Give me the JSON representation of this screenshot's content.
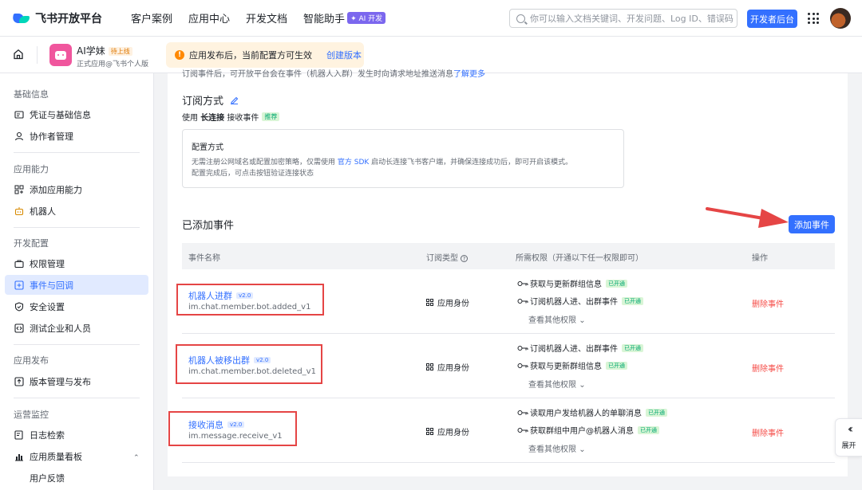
{
  "topnav": {
    "brand": "飞书开放平台",
    "links": [
      "客户案例",
      "应用中心",
      "开发文档",
      "智能助手"
    ],
    "ai_badge": "AI 开发",
    "search_placeholder": "你可以输入文档关键词、开发问题、Log ID、错误码",
    "dev_button": "开发者后台"
  },
  "appbar": {
    "app_name": "AI学妹",
    "status_badge": "待上线",
    "app_sub": "正式应用@飞书个人版",
    "notice_text": "应用发布后，当前配置方可生效",
    "notice_link": "创建版本"
  },
  "sidebar": {
    "groups": [
      "基础信息",
      "应用能力",
      "开发配置",
      "应用发布",
      "运营监控"
    ],
    "items": [
      "凭证与基础信息",
      "协作者管理",
      "添加应用能力",
      "机器人",
      "权限管理",
      "事件与回调",
      "安全设置",
      "测试企业和人员",
      "版本管理与发布",
      "日志检索",
      "应用质量看板",
      "用户反馈"
    ]
  },
  "main": {
    "clipped_line": "订阅事件后，可开放平台会在事件（机器人入群）发生时向请求地址推送消息",
    "clipped_link": "了解更多",
    "sub_title": "订阅方式",
    "sub_desc_prefix": "使用",
    "sub_desc_strong": "长连接",
    "sub_desc_suffix": "接收事件",
    "recommended": "推荐",
    "config_title": "配置方式",
    "config_line1_a": "无需注册公网域名或配置加密策略，仅需使用",
    "config_line1_link": "官方 SDK",
    "config_line1_b": "启动长连接飞书客户端，并确保连接成功后，即可开启该模式。",
    "config_line2": "配置完成后，可点击按钮验证连接状态",
    "added_title": "已添加事件",
    "add_button": "添加事件",
    "table_headers": [
      "事件名称",
      "订阅类型",
      "所需权限（开通以下任一权限即可）",
      "操作"
    ],
    "rows": [
      {
        "name": "机器人进群",
        "version": "v2.0",
        "key": "im.chat.member.bot.added_v1",
        "identity": "应用身份",
        "perms": [
          {
            "label": "获取与更新群组信息",
            "status": "已开通"
          },
          {
            "label": "订阅机器人进、出群事件",
            "status": "已开通"
          }
        ],
        "view_more": "查看其他权限",
        "delete": "删除事件"
      },
      {
        "name": "机器人被移出群",
        "version": "v2.0",
        "key": "im.chat.member.bot.deleted_v1",
        "identity": "应用身份",
        "perms": [
          {
            "label": "订阅机器人进、出群事件",
            "status": "已开通"
          },
          {
            "label": "获取与更新群组信息",
            "status": "已开通"
          }
        ],
        "view_more": "查看其他权限",
        "delete": "删除事件"
      },
      {
        "name": "接收消息",
        "version": "v2.0",
        "key": "im.message.receive_v1",
        "identity": "应用身份",
        "perms": [
          {
            "label": "读取用户发给机器人的单聊消息",
            "status": "已开通"
          },
          {
            "label": "获取群组中用户@机器人消息",
            "status": "已开通"
          }
        ],
        "view_more": "查看其他权限",
        "delete": "删除事件"
      }
    ]
  },
  "expand_label": "展开",
  "colors": {
    "accent": "#3370ff",
    "danger": "#f54a45",
    "success": "#00a870",
    "annotation": "#e54545"
  }
}
